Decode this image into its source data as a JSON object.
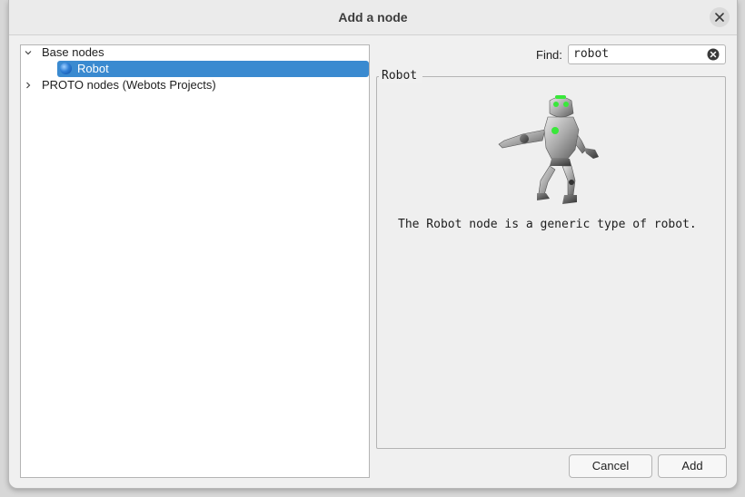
{
  "window": {
    "title": "Add a node"
  },
  "tree": {
    "items": [
      {
        "label": "Base nodes",
        "expanded": true
      },
      {
        "label": "Robot",
        "selected": true,
        "icon": "node-sphere-icon"
      },
      {
        "label": "PROTO nodes (Webots Projects)",
        "expanded": false
      }
    ]
  },
  "find": {
    "label": "Find:",
    "value": "robot"
  },
  "preview": {
    "group_title": "Robot",
    "description": "The Robot node is a generic type of robot."
  },
  "buttons": {
    "cancel": "Cancel",
    "add": "Add"
  },
  "colors": {
    "selection": "#3a8ad0",
    "robot_led": "#39e83a"
  }
}
